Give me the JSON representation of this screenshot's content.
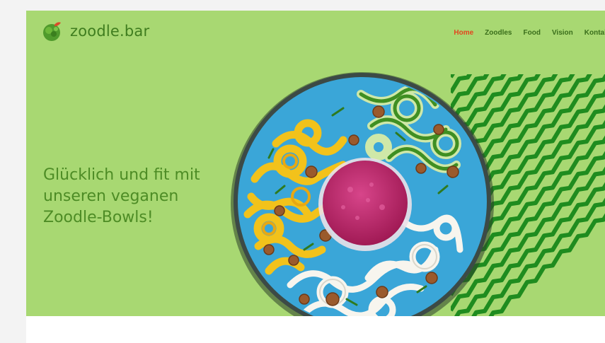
{
  "header": {
    "logo_text": "zoodle.bar",
    "nav": [
      {
        "label": "Home",
        "active": true
      },
      {
        "label": "Zoodles",
        "active": false
      },
      {
        "label": "Food",
        "active": false
      },
      {
        "label": "Vision",
        "active": false
      },
      {
        "label": "Kontakt",
        "active": false
      }
    ]
  },
  "hero": {
    "heading_lines": [
      "Glücklich und fit mit",
      "unseren veganen",
      "Zoodle-Bowls!"
    ]
  },
  "colors": {
    "hero_bg": "#a8d872",
    "brand_green": "#3f7d1f",
    "nav_active": "#e3461e",
    "wave_green": "#1f8c1f",
    "plate_blue": "#3aa6d8",
    "beet_pink": "#c2276c"
  },
  "icons": {
    "logo": "leafy-bowl-icon"
  }
}
